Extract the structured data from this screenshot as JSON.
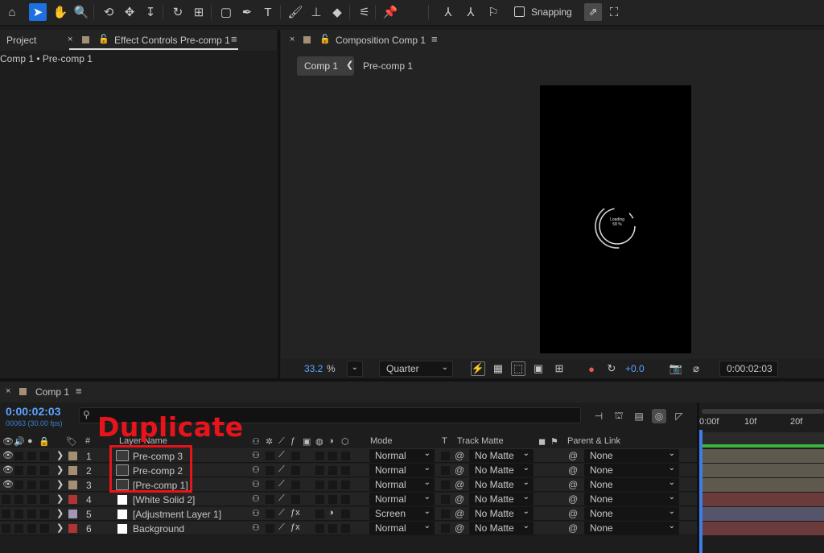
{
  "toolbar": {
    "tools": [
      {
        "icon": "home-icon",
        "glyph": "⌂"
      },
      {
        "icon": "selection-tool-icon",
        "glyph": "➤"
      },
      {
        "icon": "hand-tool-icon",
        "glyph": "✋"
      },
      {
        "icon": "zoom-tool-icon",
        "glyph": "🔍"
      },
      {
        "icon": "orbit-camera-icon",
        "glyph": "⟲"
      },
      {
        "icon": "pan-camera-icon",
        "glyph": "✥"
      },
      {
        "icon": "dolly-camera-icon",
        "glyph": "↧"
      },
      {
        "icon": "rotation-tool-icon",
        "glyph": "↻"
      },
      {
        "icon": "pan-behind-tool-icon",
        "glyph": "⊞"
      },
      {
        "icon": "rectangle-tool-icon",
        "glyph": "▢"
      },
      {
        "icon": "pen-tool-icon",
        "glyph": "✒"
      },
      {
        "icon": "type-tool-icon",
        "glyph": "T"
      },
      {
        "icon": "brush-tool-icon",
        "glyph": "🖌"
      },
      {
        "icon": "clone-stamp-tool-icon",
        "glyph": "⊥"
      },
      {
        "icon": "eraser-tool-icon",
        "glyph": "◆"
      },
      {
        "icon": "roto-brush-tool-icon",
        "glyph": "⚟"
      },
      {
        "icon": "puppet-pin-tool-icon",
        "glyph": "📌"
      },
      {
        "icon": "axis-local-icon",
        "glyph": "⅄"
      },
      {
        "icon": "axis-world-icon",
        "glyph": "⅄"
      },
      {
        "icon": "axis-view-icon",
        "glyph": "⚐"
      }
    ],
    "snapping_label": "Snapping"
  },
  "left_panel": {
    "project_tab": "Project",
    "effect_controls_tab": "Effect Controls Pre-comp 1",
    "breadcrumb": "Comp 1 • Pre-comp 1"
  },
  "comp_panel": {
    "tab_title": "Composition Comp 1",
    "active_tab": "Comp 1",
    "second_tab": "Pre-comp 1",
    "loader_text_line1": "Loading",
    "loader_text_line2": "58 %",
    "zoom_value": "33.2",
    "zoom_unit": "%",
    "resolution": "Quarter",
    "exposure": "+0.0",
    "timecode": "0:00:02:03"
  },
  "timeline": {
    "tab_title": "Comp 1",
    "current_time": "0:00:02:03",
    "frame_info": "00063 (30.00 fps)",
    "annotation": "Duplicate",
    "headers": {
      "number": "#",
      "layer_name": "Layer Name",
      "mode": "Mode",
      "track_t": "T",
      "track_matte": "Track Matte",
      "parent_link": "Parent & Link"
    },
    "ruler_ticks": [
      "0:00f",
      "10f",
      "20f"
    ],
    "layers": [
      {
        "num": "1",
        "name": "Pre-comp 3",
        "label_color": "#a58f74",
        "type": "precomp",
        "mode": "Normal",
        "matte": "No Matte",
        "parent": "None",
        "visible": true,
        "fx": false,
        "bar_color": "#5f584e"
      },
      {
        "num": "2",
        "name": "Pre-comp 2",
        "label_color": "#a58f74",
        "type": "precomp",
        "mode": "Normal",
        "matte": "No Matte",
        "parent": "None",
        "visible": true,
        "fx": false,
        "bar_color": "#5f584e"
      },
      {
        "num": "3",
        "name": "[Pre-comp 1]",
        "label_color": "#a58f74",
        "type": "precomp",
        "mode": "Normal",
        "matte": "No Matte",
        "parent": "None",
        "visible": true,
        "fx": false,
        "bar_color": "#5f584e"
      },
      {
        "num": "4",
        "name": "[White Solid 2]",
        "label_color": "#b03434",
        "type": "solid",
        "mode": "Normal",
        "matte": "No Matte",
        "parent": "None",
        "visible": false,
        "fx": false,
        "bar_color": "#6b3a3a"
      },
      {
        "num": "5",
        "name": "[Adjustment Layer 1]",
        "label_color": "#a396b8",
        "type": "solid",
        "mode": "Screen",
        "matte": "No Matte",
        "parent": "None",
        "visible": false,
        "fx": true,
        "bar_color": "#56546a"
      },
      {
        "num": "6",
        "name": "Background",
        "label_color": "#b03434",
        "type": "solid",
        "mode": "Normal",
        "matte": "No Matte",
        "parent": "None",
        "visible": false,
        "fx": true,
        "bar_color": "#6b3a3a"
      }
    ]
  }
}
